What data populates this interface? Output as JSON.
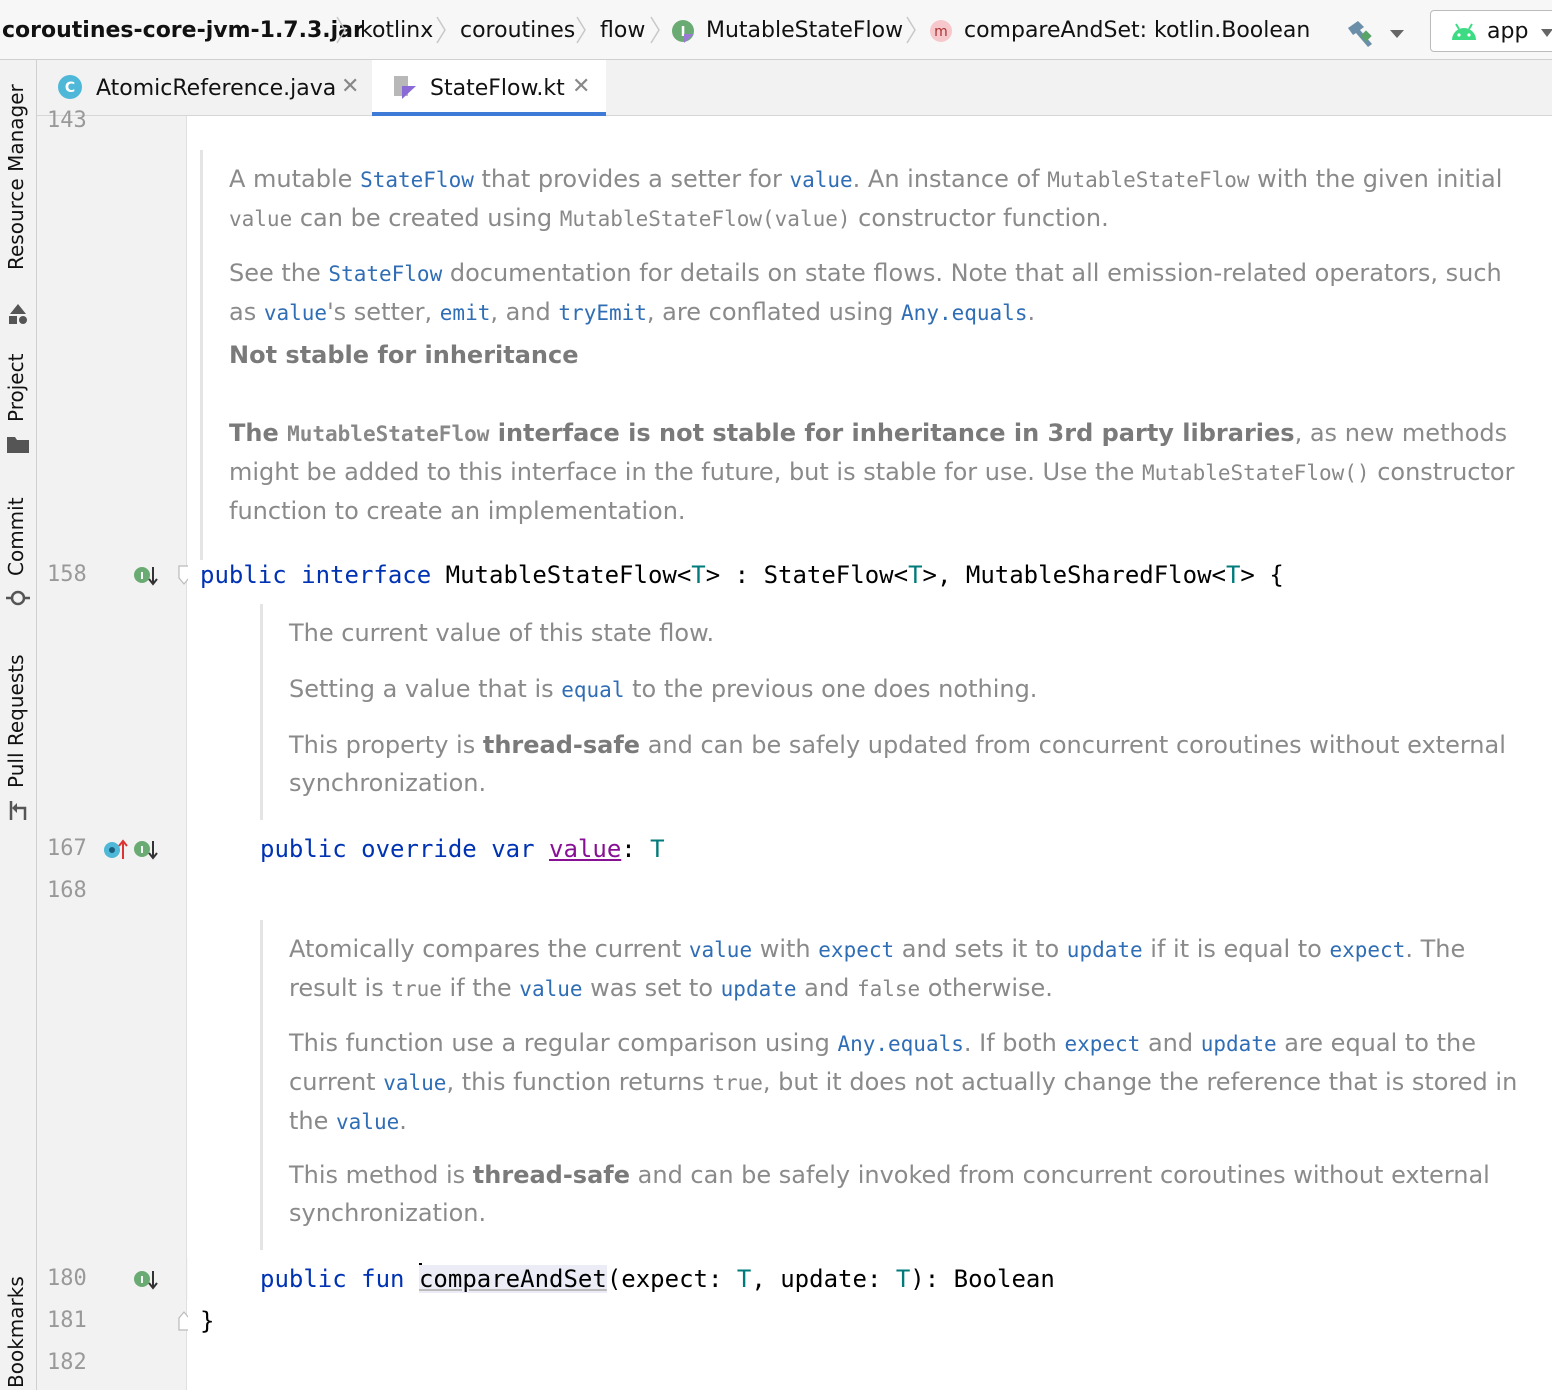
{
  "breadcrumbs": {
    "jar": "coroutines-core-jvm-1.7.3.jar",
    "pkg1": "kotlinx",
    "pkg2": "coroutines",
    "pkg3": "flow",
    "interface": "MutableStateFlow",
    "method": "compareAndSet: kotlin.Boolean",
    "run_config": "app"
  },
  "toolwindows": {
    "resource_manager": "Resource Manager",
    "project": "Project",
    "commit": "Commit",
    "pull_requests": "Pull Requests",
    "bookmarks": "Bookmarks"
  },
  "tabs": [
    {
      "label": "AtomicReference.java"
    },
    {
      "label": "StateFlow.kt"
    }
  ],
  "gutter": {
    "l143": "143",
    "l158": "158",
    "l167": "167",
    "l168": "168",
    "l180": "180",
    "l181": "181",
    "l182": "182"
  },
  "doc1": {
    "p1_a": "A mutable ",
    "p1_stateflow": "StateFlow",
    "p1_b": " that provides a setter for ",
    "p1_value": "value",
    "p1_c": ". An instance of ",
    "p1_msf": "MutableStateFlow",
    "p1_d": " with the given initial ",
    "p1_value2": "value",
    "p1_e": " can be created using ",
    "p1_ctor": "MutableStateFlow(value)",
    "p1_f": " constructor function.",
    "p2_a": "See the ",
    "p2_stateflow": "StateFlow",
    "p2_b": " documentation for details on state flows. Note that all emission-related operators, such as ",
    "p2_value": "value",
    "p2_c": "'s setter, ",
    "p2_emit": "emit",
    "p2_d": ", and ",
    "p2_tryemit": "tryEmit",
    "p2_e": ", are conflated using ",
    "p2_equals": "Any.equals",
    "p2_f": ".",
    "heading": "Not stable for inheritance",
    "p3_a": "The ",
    "p3_msf": "MutableStateFlow",
    "p3_b": " interface is not stable for inheritance in 3rd party libraries",
    "p3_c": ", as new methods might be added to this interface in the future, but is stable for use. Use the ",
    "p3_ctor": "MutableStateFlow()",
    "p3_d": " constructor function to create an implementation."
  },
  "code158": {
    "kw_public": "public",
    "kw_interface": "interface",
    "name": "MutableStateFlow",
    "t1": "T",
    "colon": " : ",
    "sf": "StateFlow",
    "t2": "T",
    "comma": ", ",
    "msf": "MutableSharedFlow",
    "t3": "T",
    "brace": " {"
  },
  "doc2": {
    "p1": "The current value of this state flow.",
    "p2_a": "Setting a value that is ",
    "p2_equal": "equal",
    "p2_b": " to the previous one does nothing.",
    "p3_a": "This property is ",
    "p3_bold": "thread-safe",
    "p3_b": " and can be safely updated from concurrent coroutines without external synchronization."
  },
  "code167": {
    "kw_public": "public",
    "kw_override": "override",
    "kw_var": "var",
    "prop": "value",
    "colon": ": ",
    "type": "T"
  },
  "doc3": {
    "p1_a": "Atomically compares the current ",
    "p1_value": "value",
    "p1_b": " with ",
    "p1_expect": "expect",
    "p1_c": " and sets it to ",
    "p1_update": "update",
    "p1_d": " if it is equal to ",
    "p1_expect2": "expect",
    "p1_e": ". The result is ",
    "p1_true": "true",
    "p1_f": " if the ",
    "p1_value2": "value",
    "p1_g": " was set to ",
    "p1_update2": "update",
    "p1_h": " and ",
    "p1_false": "false",
    "p1_i": " otherwise.",
    "p2_a": "This function use a regular comparison using ",
    "p2_equals": "Any.equals",
    "p2_b": ". If both ",
    "p2_expect": "expect",
    "p2_c": " and ",
    "p2_update": "update",
    "p2_d": " are equal to the current ",
    "p2_value": "value",
    "p2_e": ", this function returns ",
    "p2_true": "true",
    "p2_f": ", but it does not actually change the reference that is stored in the ",
    "p2_value2": "value",
    "p2_g": ".",
    "p3_a": "This method is ",
    "p3_bold": "thread-safe",
    "p3_b": " and can be safely invoked from concurrent coroutines without external synchronization."
  },
  "code180": {
    "kw_public": "public",
    "kw_fun": "fun",
    "name": "compareAndSet",
    "open": "(",
    "p1": "expect",
    "c1": ": ",
    "t1": "T",
    "comma": ", ",
    "p2": "update",
    "c2": ": ",
    "t2": "T",
    "close": "): ",
    "ret": "Boolean"
  },
  "code181": {
    "brace": "}"
  }
}
